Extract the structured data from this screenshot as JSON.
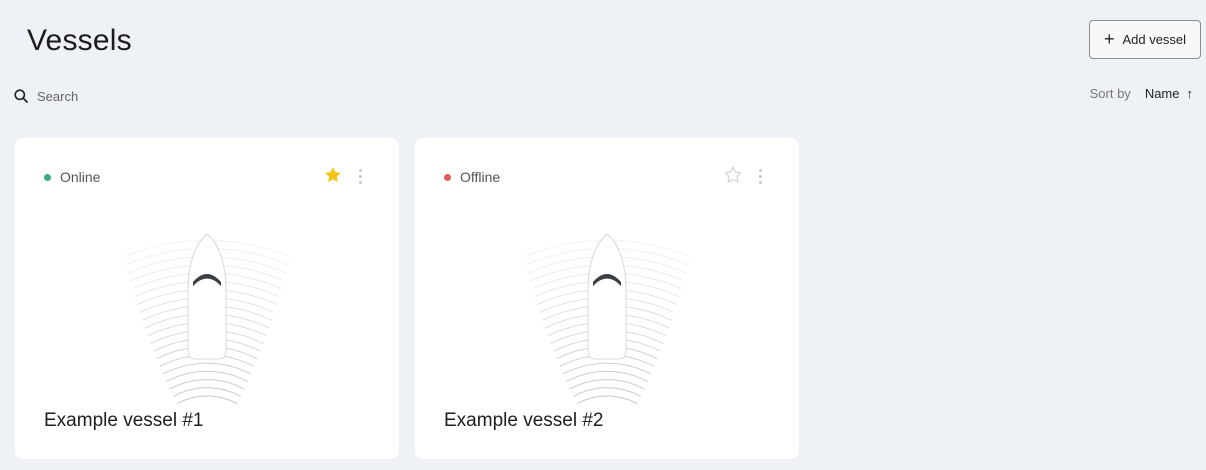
{
  "header": {
    "title": "Vessels",
    "add_label": "Add vessel"
  },
  "search": {
    "placeholder": "Search",
    "value": ""
  },
  "sort": {
    "label": "Sort by",
    "value": "Name",
    "direction_icon": "arrow-up-icon"
  },
  "colors": {
    "online": "#3fa886",
    "offline": "#e05a5a",
    "star_active": "#f5c518",
    "star_inactive": "#cfd3d7"
  },
  "vessels": [
    {
      "name": "Example vessel #1",
      "status": "Online",
      "favorite": true
    },
    {
      "name": "Example vessel #2",
      "status": "Offline",
      "favorite": false
    }
  ]
}
